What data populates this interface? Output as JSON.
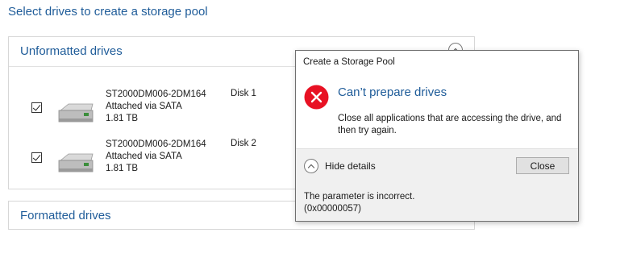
{
  "page": {
    "heading": "Select drives to create a storage pool"
  },
  "unformatted": {
    "title": "Unformatted drives",
    "drives": [
      {
        "model": "ST2000DM006-2DM164",
        "connection": "Attached via SATA",
        "size": "1.81 TB",
        "disk": "Disk 1",
        "checked": true
      },
      {
        "model": "ST2000DM006-2DM164",
        "connection": "Attached via SATA",
        "size": "1.81 TB",
        "disk": "Disk 2",
        "checked": true
      }
    ]
  },
  "formatted": {
    "title": "Formatted drives"
  },
  "dialog": {
    "title": "Create a Storage Pool",
    "main_instruction": "Can’t prepare drives",
    "message": "Close all applications that are accessing the drive, and then try again.",
    "hide_details_label": "Hide details",
    "close_label": "Close",
    "details_line1": "The parameter is incorrect.",
    "details_line2": "(0x00000057)"
  },
  "icons": {
    "error": "error-icon",
    "drive": "hard-drive-icon",
    "collapse": "chevron-up-icon"
  },
  "colors": {
    "accent": "#1f5c99",
    "error": "#e81123",
    "dialog_footer": "#f0f0f0"
  }
}
